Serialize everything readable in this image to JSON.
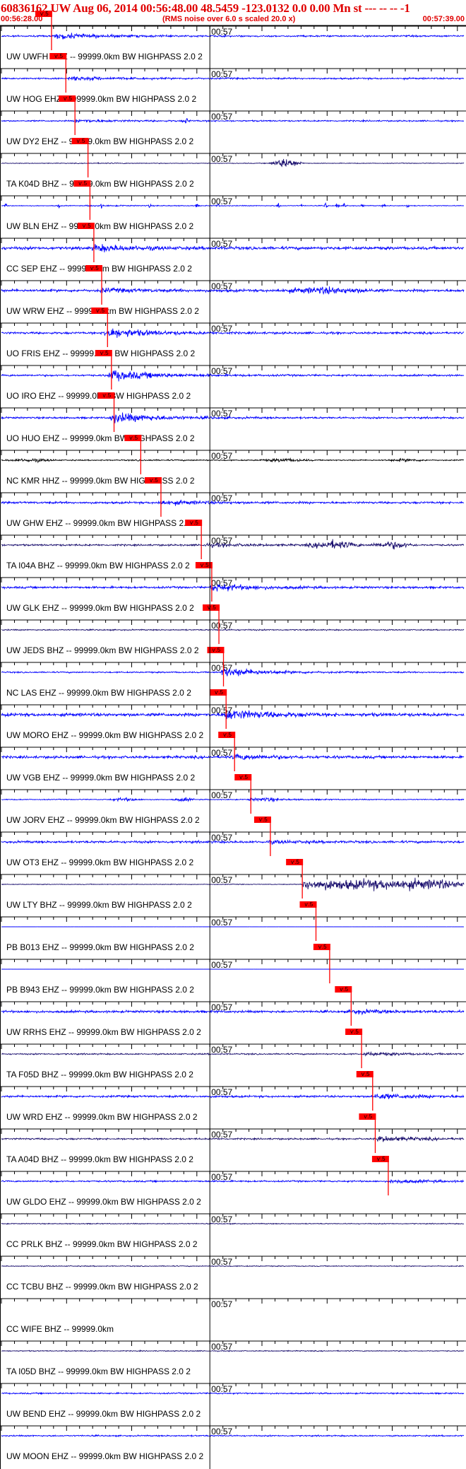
{
  "header": {
    "title": "60836162 UW Aug 06, 2014 00:56:48.00   48.5459 -123.0132  0.0 0.00 Mn st --- -- --  -1",
    "start_time": "00:56:28.00",
    "note": "(RMS noise over 6.0 s scaled 20.0 x)",
    "end_time": "00:57:39.00"
  },
  "colors": {
    "header_text": "#e00000",
    "trace_blue": "#0000ff",
    "trace_dark": "#1a0f6e",
    "trace_black": "#000000",
    "pick_red": "#ff0000"
  },
  "chart_data": {
    "type": "line",
    "title": "60836162 UW Aug 06, 2014 00:56:48.00   48.5459 -123.0132  0.0 0.00 Mn st --- -- --  -1",
    "x_start": "00:56:28.00",
    "x_end": "00:57:39.00",
    "x_units": "seconds from 00:56:28.00",
    "x_range": [
      0,
      71
    ],
    "minute_mark": "00:57",
    "minute_mark_seconds": 32,
    "tick_interval_seconds": 2,
    "pick_label": "ѵ.5",
    "stations": [
      {
        "label": "UW UWFH EHZ -- 99999.0km BW  HIGHPASS  2.0  2",
        "color": "blue",
        "pick": 6.5,
        "arrival": 8.0,
        "amplitude": 0.55,
        "noise": 0.14,
        "bursts": []
      },
      {
        "label": "UW HOG EHZ -- 99999.0km BW  HIGHPASS  2.0  2",
        "color": "blue",
        "pick": 8.7,
        "arrival": 10.2,
        "amplitude": 0.35,
        "noise": 0.14,
        "bursts": []
      },
      {
        "label": "UW DY2 EHZ -- 99999.0km BW  HIGHPASS  2.0  2",
        "color": "blue",
        "pick": 10.1,
        "arrival": 11.0,
        "amplitude": 0.25,
        "noise": 0.12,
        "bursts": [
          {
            "t": 28.4,
            "amp": 0.45,
            "dur": 0.7
          }
        ]
      },
      {
        "label": "TA K04D BHZ -- 99999.0km BW  HIGHPASS  2.0  2",
        "color": "dark",
        "pick": 12.1,
        "arrival": 12.7,
        "amplitude": 0.05,
        "noise": 0.06,
        "bursts": [
          {
            "t": 43.7,
            "amp": 0.9,
            "dur": 3.0
          }
        ]
      },
      {
        "label": "UW BLN EHZ -- 99999.0km BW  HIGHPASS  2.0  2",
        "color": "blue",
        "pick": 12.4,
        "arrival": 12.9,
        "amplitude": 0.1,
        "noise": 0.07,
        "bursts": [
          {
            "t": 0.6,
            "amp": 0.6,
            "dur": 0.3
          },
          {
            "t": 8.8,
            "amp": 0.45,
            "dur": 0.3
          },
          {
            "t": 15.4,
            "amp": 0.35,
            "dur": 0.3
          },
          {
            "t": 22.8,
            "amp": 0.45,
            "dur": 0.3
          },
          {
            "t": 30.0,
            "amp": 0.35,
            "dur": 0.3
          },
          {
            "t": 33.2,
            "amp": 0.4,
            "dur": 0.3
          },
          {
            "t": 42.6,
            "amp": 0.55,
            "dur": 0.4
          },
          {
            "t": 46.1,
            "amp": 0.4,
            "dur": 0.3
          },
          {
            "t": 49.8,
            "amp": 0.55,
            "dur": 0.4
          },
          {
            "t": 51.5,
            "amp": 0.6,
            "dur": 0.4
          },
          {
            "t": 52.8,
            "amp": 0.6,
            "dur": 0.4
          },
          {
            "t": 55.5,
            "amp": 0.45,
            "dur": 0.3
          },
          {
            "t": 58.7,
            "amp": 0.45,
            "dur": 0.3
          },
          {
            "t": 62.4,
            "amp": 0.5,
            "dur": 0.3
          }
        ]
      },
      {
        "label": "CC SEP EHZ -- 99999.0km BW  HIGHPASS  2.0  2",
        "color": "blue",
        "pick": 13.0,
        "arrival": 13.9,
        "amplitude": 0.6,
        "noise": 0.25,
        "bursts": []
      },
      {
        "label": "UW WRW EHZ -- 99999.0km BW  HIGHPASS  2.0  2",
        "color": "blue",
        "pick": 14.2,
        "arrival": 14.9,
        "amplitude": 0.3,
        "noise": 0.22,
        "bursts": [
          {
            "t": 50.0,
            "amp": 0.5,
            "dur": 9.0
          }
        ]
      },
      {
        "label": "UO FRIS EHZ -- 99999.0km BW  HIGHPASS  2.0  2",
        "color": "blue",
        "pick": 15.1,
        "arrival": 15.6,
        "amplitude": 1.0,
        "noise": 0.18,
        "bursts": []
      },
      {
        "label": "UO IRO EHZ -- 99999.0km BW  HIGHPASS  2.0  2",
        "color": "blue",
        "pick": 15.7,
        "arrival": 16.3,
        "amplitude": 1.0,
        "noise": 0.16,
        "bursts": []
      },
      {
        "label": "UO HUO EHZ -- 99999.0km BW  HIGHPASS  2.0  2",
        "color": "blue",
        "pick": 16.1,
        "arrival": 16.6,
        "amplitude": 1.0,
        "noise": 0.16,
        "bursts": []
      },
      {
        "label": "NC KMR HHZ -- 99999.0km BW  HIGHPASS  2.0  2",
        "color": "black",
        "pick": 20.2,
        "arrival": 20.4,
        "amplitude": 0.05,
        "noise": 0.1,
        "bursts": [
          {
            "t": 4.5,
            "amp": 0.25,
            "dur": 5.0
          },
          {
            "t": 43.5,
            "amp": 0.25,
            "dur": 5.0
          },
          {
            "t": 62.0,
            "amp": 0.2,
            "dur": 4.0
          }
        ]
      },
      {
        "label": "UW GHW EHZ -- 99999.0km BW  HIGHPASS  2.0  2",
        "color": "blue",
        "pick": 23.3,
        "arrival": 24.0,
        "amplitude": 0.4,
        "noise": 0.18,
        "bursts": []
      },
      {
        "label": "TA I04A BHZ -- 99999.0km BW  HIGHPASS  2.0  2",
        "color": "dark",
        "pick": 29.5,
        "arrival": 30.8,
        "amplitude": 0.3,
        "noise": 0.15,
        "bursts": [
          {
            "t": 51.0,
            "amp": 0.7,
            "dur": 5.0
          },
          {
            "t": 60.0,
            "amp": 0.6,
            "dur": 4.0
          }
        ]
      },
      {
        "label": "UW GLK EHZ -- 99999.0km BW  HIGHPASS  2.0  2",
        "color": "blue",
        "pick": 31.1,
        "arrival": 32.0,
        "amplitude": 0.7,
        "noise": 0.18,
        "bursts": []
      },
      {
        "label": "UW JEDS BHZ -- 99999.0km BW  HIGHPASS  2.0  2",
        "color": "dark",
        "pick": 32.2,
        "arrival": 32.5,
        "amplitude": 0.05,
        "noise": 0.1,
        "bursts": []
      },
      {
        "label": "NC LAS EHZ -- 99999.0km BW  HIGHPASS  2.0  2",
        "color": "blue",
        "pick": 32.9,
        "arrival": 33.6,
        "amplitude": 0.9,
        "noise": 0.12,
        "bursts": []
      },
      {
        "label": "UW MORO EHZ -- 99999.0km BW  HIGHPASS  2.0  2",
        "color": "blue",
        "pick": 33.3,
        "arrival": 34.0,
        "amplitude": 0.9,
        "noise": 0.28,
        "bursts": []
      },
      {
        "label": "UW VGB EHZ -- 99999.0km BW  HIGHPASS  2.0  2",
        "color": "blue",
        "pick": 34.6,
        "arrival": 35.3,
        "amplitude": 0.45,
        "noise": 0.22,
        "bursts": []
      },
      {
        "label": "UW JORV EHZ -- 99999.0km BW  HIGHPASS  2.0  2",
        "color": "blue",
        "pick": 37.1,
        "arrival": 37.7,
        "amplitude": 0.2,
        "noise": 0.08,
        "bursts": [
          {
            "t": 19.0,
            "amp": 0.3,
            "dur": 3.0
          },
          {
            "t": 28.0,
            "amp": 0.3,
            "dur": 2.0
          },
          {
            "t": 41.0,
            "amp": 0.2,
            "dur": 2.0
          }
        ]
      },
      {
        "label": "UW OT3 EHZ -- 99999.0km BW  HIGHPASS  2.0  2",
        "color": "blue",
        "pick": 40.1,
        "arrival": 40.7,
        "amplitude": 0.2,
        "noise": 0.2,
        "bursts": []
      },
      {
        "label": "UW LTY BHZ -- 99999.0km BW  HIGHPASS  2.0  2",
        "color": "dark",
        "pick": 45.0,
        "arrival": 46.3,
        "amplitude": 1.0,
        "noise": 0.06,
        "bursts": []
      },
      {
        "label": "PB B013 EHZ -- 99999.0km BW  HIGHPASS  2.0  2",
        "color": "blue",
        "pick": 47.1,
        "arrival": 47.4,
        "amplitude": 0.0,
        "noise": 0.01,
        "bursts": []
      },
      {
        "label": "PB B943 EHZ -- 99999.0km BW  HIGHPASS  2.0  2",
        "color": "blue",
        "pick": 49.2,
        "arrival": 49.5,
        "amplitude": 0.0,
        "noise": 0.01,
        "bursts": []
      },
      {
        "label": "UW RRHS EHZ -- 99999.0km BW  HIGHPASS  2.0  2",
        "color": "blue",
        "pick": 52.5,
        "arrival": 53.3,
        "amplitude": 0.3,
        "noise": 0.2,
        "bursts": []
      },
      {
        "label": "TA F05D BHZ -- 99999.0km BW  HIGHPASS  2.0  2",
        "color": "dark",
        "pick": 54.1,
        "arrival": 55.4,
        "amplitude": 0.3,
        "noise": 0.12,
        "bursts": []
      },
      {
        "label": "UW WRD EHZ -- 99999.0km BW  HIGHPASS  2.0  2",
        "color": "blue",
        "pick": 55.8,
        "arrival": 56.8,
        "amplitude": 0.5,
        "noise": 0.18,
        "bursts": []
      },
      {
        "label": "TA A04D BHZ -- 99999.0km BW  HIGHPASS  2.0  2",
        "color": "dark",
        "pick": 56.2,
        "arrival": 57.4,
        "amplitude": 0.5,
        "noise": 0.14,
        "bursts": []
      },
      {
        "label": "UW GLDO EHZ -- 99999.0km BW  HIGHPASS  2.0  2",
        "color": "blue",
        "pick": 58.2,
        "arrival": 59.3,
        "amplitude": 0.3,
        "noise": 0.14,
        "bursts": []
      },
      {
        "label": "CC PRLK BHZ -- 99999.0km BW  HIGHPASS  2.0  2",
        "color": "dark",
        "pick": null,
        "arrival": null,
        "amplitude": 0.0,
        "noise": 0.08,
        "bursts": []
      },
      {
        "label": "CC TCBU BHZ -- 99999.0km BW  HIGHPASS  2.0  2",
        "color": "dark",
        "pick": null,
        "arrival": null,
        "amplitude": 0.0,
        "noise": 0.08,
        "bursts": []
      },
      {
        "label": "CC WIFE BHZ -- 99999.0km",
        "color": "dark",
        "pick": null,
        "arrival": null,
        "amplitude": 0.0,
        "noise": 0.0,
        "bursts": []
      },
      {
        "label": "TA I05D BHZ -- 99999.0km BW  HIGHPASS  2.0  2",
        "color": "dark",
        "pick": null,
        "arrival": null,
        "amplitude": 0.0,
        "noise": 0.08,
        "bursts": []
      },
      {
        "label": "UW BEND EHZ -- 99999.0km BW  HIGHPASS  2.0  2",
        "color": "blue",
        "pick": null,
        "arrival": null,
        "amplitude": 0.0,
        "noise": 0.12,
        "bursts": []
      },
      {
        "label": "UW MOON EHZ -- 99999.0km BW  HIGHPASS  2.0  2",
        "color": "blue",
        "pick": null,
        "arrival": null,
        "amplitude": 0.0,
        "noise": 0.12,
        "bursts": []
      }
    ]
  }
}
